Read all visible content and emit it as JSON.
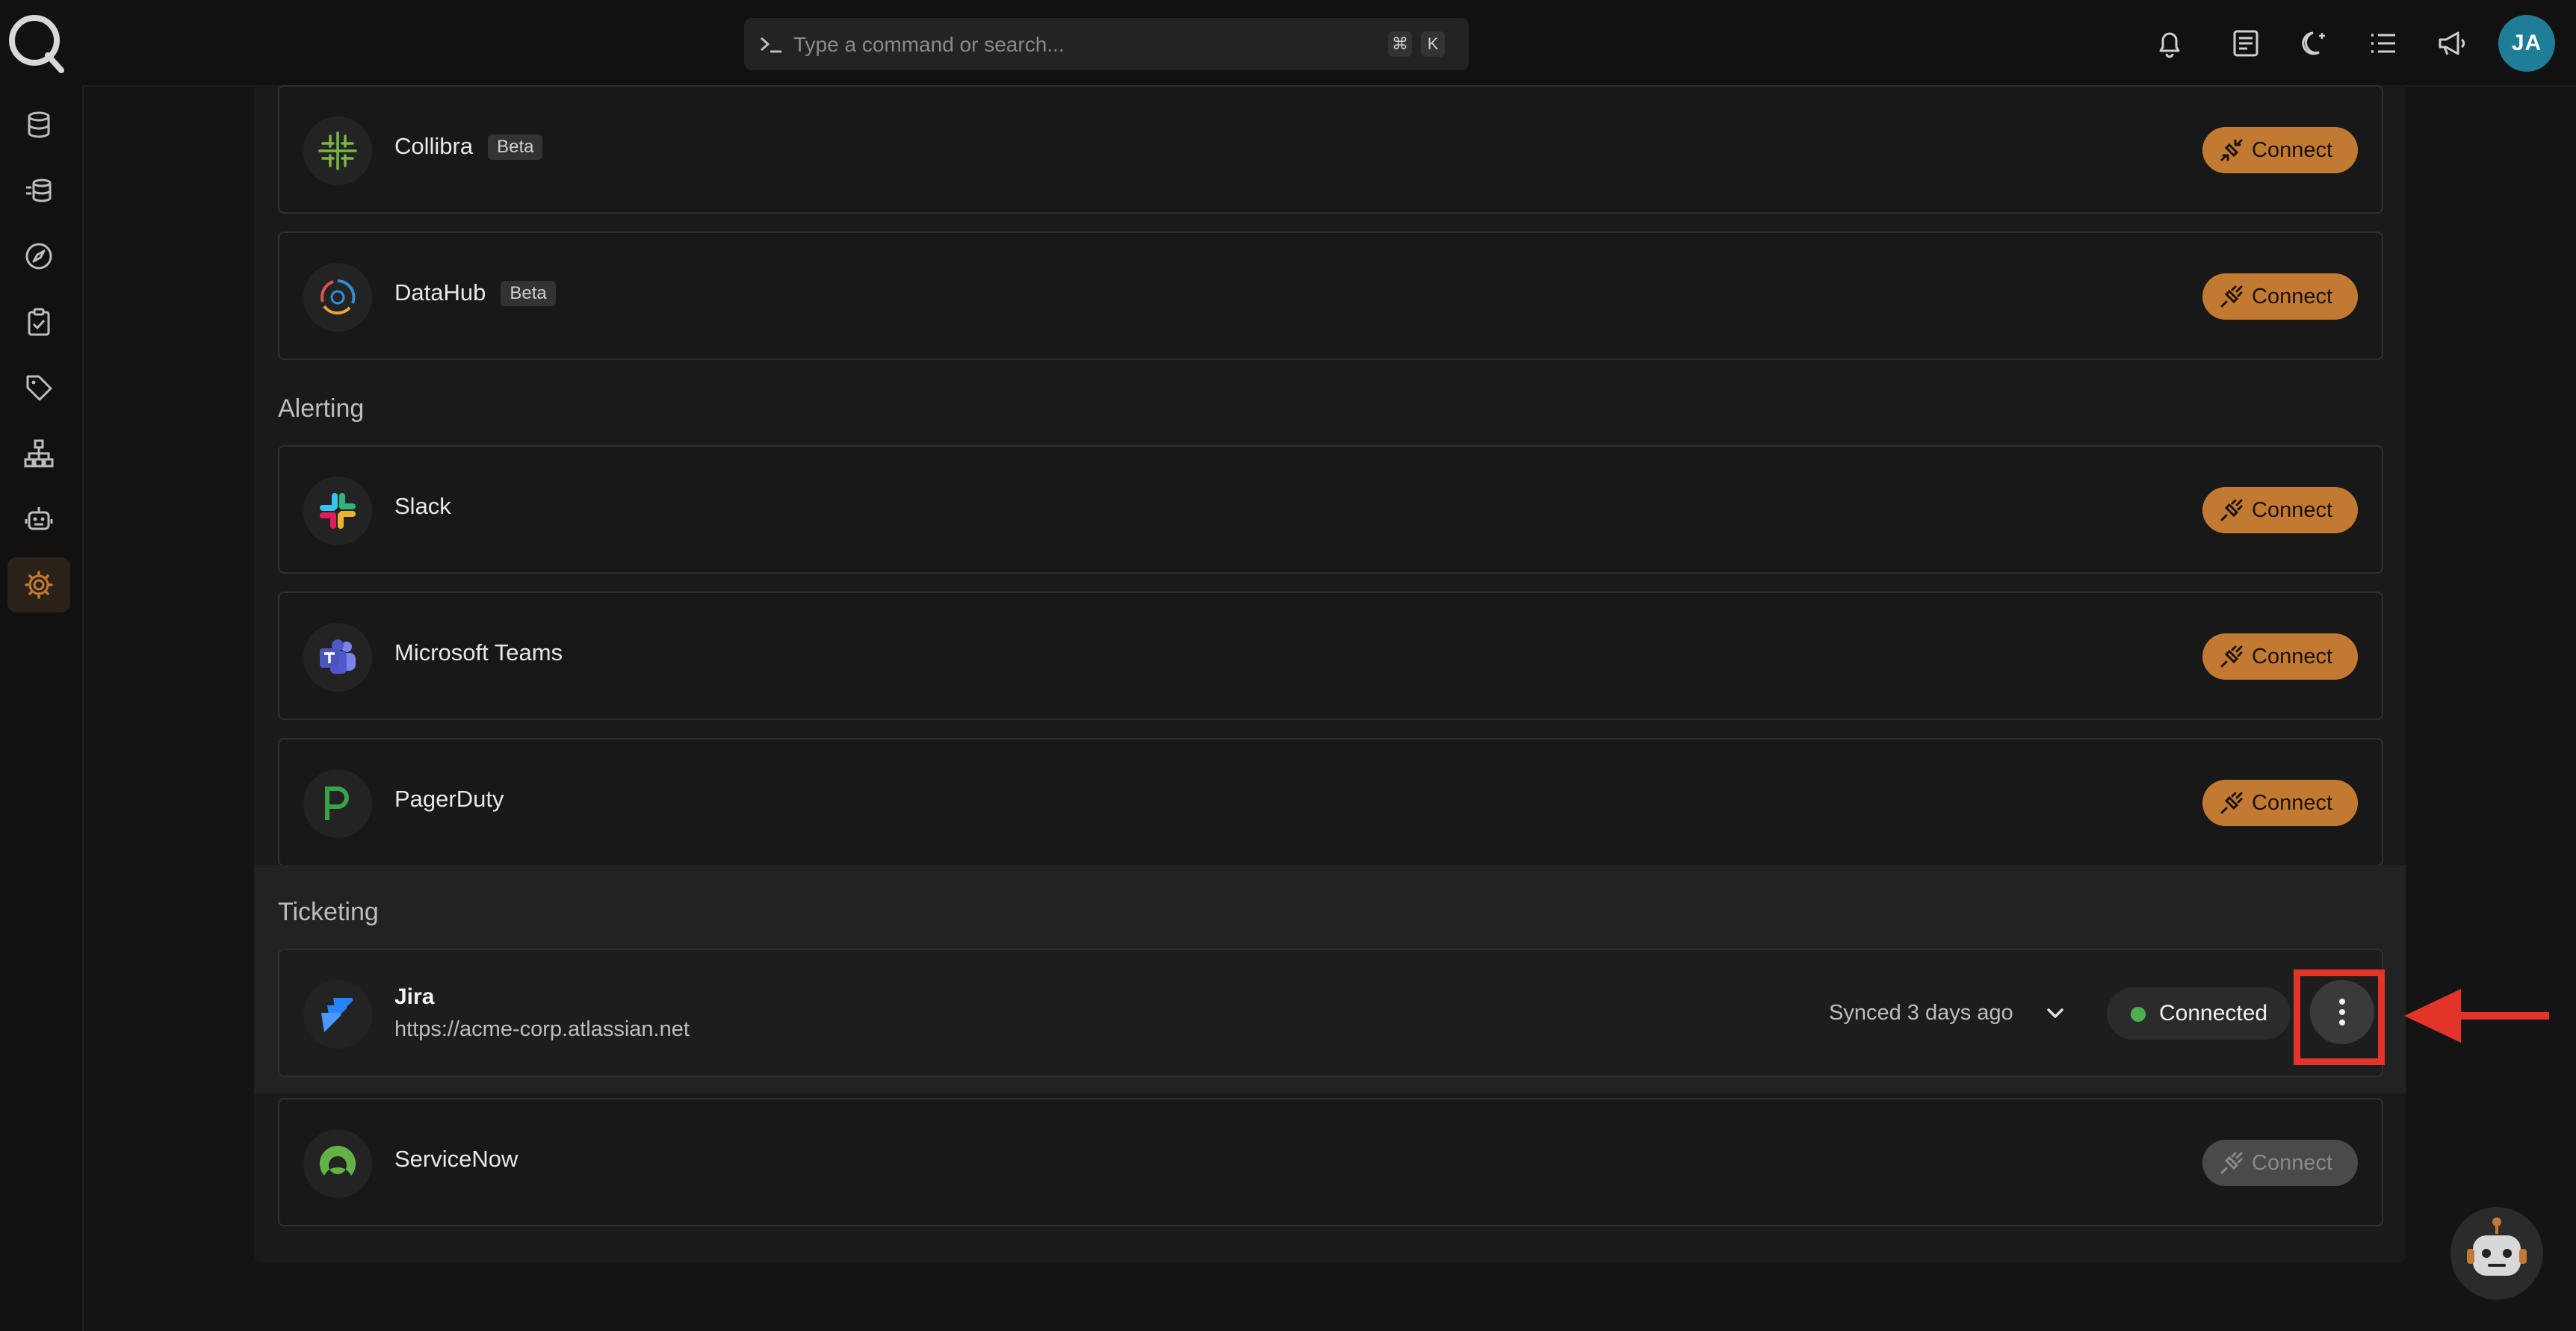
{
  "topbar": {
    "search_placeholder": "Type a command or search...",
    "shortcut_keys": [
      "⌘",
      "K"
    ],
    "user_initials": "JA"
  },
  "sidebar": {
    "items": [
      {
        "icon": "database-icon"
      },
      {
        "icon": "data-source-icon"
      },
      {
        "icon": "compass-icon"
      },
      {
        "icon": "clipboard-check-icon"
      },
      {
        "icon": "tag-icon"
      },
      {
        "icon": "hierarchy-icon"
      },
      {
        "icon": "robot-icon"
      },
      {
        "icon": "gear-icon",
        "active": true
      }
    ]
  },
  "sections": {
    "catalog": {
      "items": [
        {
          "name": "Collibra",
          "badge": "Beta",
          "action": "Connect"
        },
        {
          "name": "DataHub",
          "badge": "Beta",
          "action": "Connect"
        }
      ]
    },
    "alerting": {
      "title": "Alerting",
      "items": [
        {
          "name": "Slack",
          "action": "Connect"
        },
        {
          "name": "Microsoft Teams",
          "action": "Connect"
        },
        {
          "name": "PagerDuty",
          "action": "Connect"
        }
      ]
    },
    "ticketing": {
      "title": "Ticketing",
      "jira": {
        "name": "Jira",
        "url": "https://acme-corp.atlassian.net",
        "synced": "Synced 3 days ago",
        "status": "Connected"
      },
      "servicenow": {
        "name": "ServiceNow",
        "action": "Connect"
      }
    }
  },
  "colors": {
    "accent": "#c27a32",
    "connected": "#4caf50",
    "annotation": "#e3342a",
    "avatar": "#1f7d97"
  }
}
